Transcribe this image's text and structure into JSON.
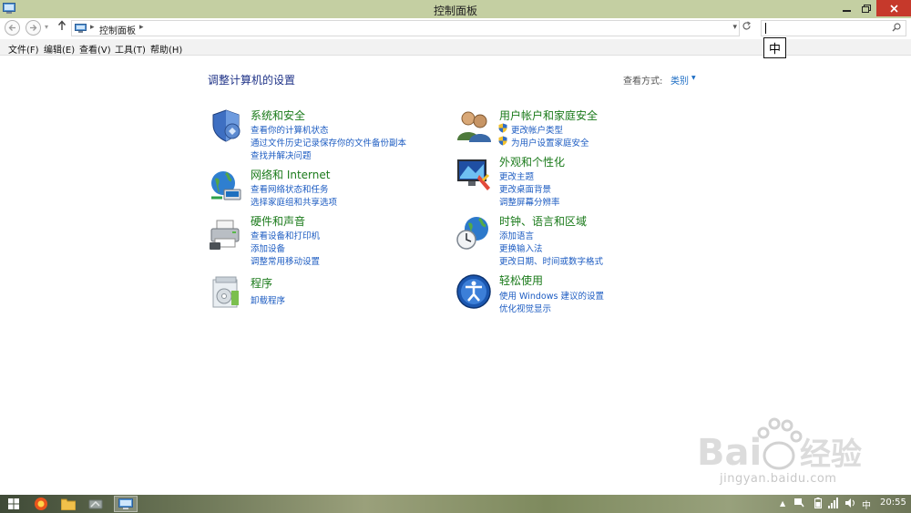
{
  "window": {
    "title": "控制面板"
  },
  "address": {
    "path": "控制面板"
  },
  "menu": [
    "文件(F)",
    "编辑(E)",
    "查看(V)",
    "工具(T)",
    "帮助(H)"
  ],
  "ime": {
    "indicator": "中"
  },
  "content": {
    "heading": "调整计算机的设置",
    "view_by_label": "查看方式:",
    "view_by_value": "类别"
  },
  "categories": [
    {
      "title": "系统和安全",
      "icon": "system-security-icon",
      "links": [
        "查看你的计算机状态",
        "通过文件历史记录保存你的文件备份副本",
        "查找并解决问题"
      ]
    },
    {
      "title": "网络和 Internet",
      "icon": "network-internet-icon",
      "links": [
        "查看网络状态和任务",
        "选择家庭组和共享选项"
      ]
    },
    {
      "title": "硬件和声音",
      "icon": "hardware-sound-icon",
      "links": [
        "查看设备和打印机",
        "添加设备",
        "调整常用移动设置"
      ]
    },
    {
      "title": "程序",
      "icon": "programs-icon",
      "links": [
        "卸载程序"
      ]
    },
    {
      "title": "用户帐户和家庭安全",
      "icon": "user-accounts-icon",
      "links": [
        "更改帐户类型",
        "为用户设置家庭安全"
      ]
    },
    {
      "title": "外观和个性化",
      "icon": "appearance-icon",
      "links": [
        "更改主题",
        "更改桌面背景",
        "调整屏幕分辨率"
      ]
    },
    {
      "title": "时钟、语言和区域",
      "icon": "clock-language-region-icon",
      "links": [
        "添加语言",
        "更换输入法",
        "更改日期、时间或数字格式"
      ]
    },
    {
      "title": "轻松使用",
      "icon": "ease-of-access-icon",
      "links": [
        "使用 Windows 建议的设置",
        "优化视觉显示"
      ]
    }
  ],
  "watermark": {
    "text": "jingyan.baidu.com"
  },
  "taskbar": {
    "ime": "中",
    "clock": "20:55"
  }
}
